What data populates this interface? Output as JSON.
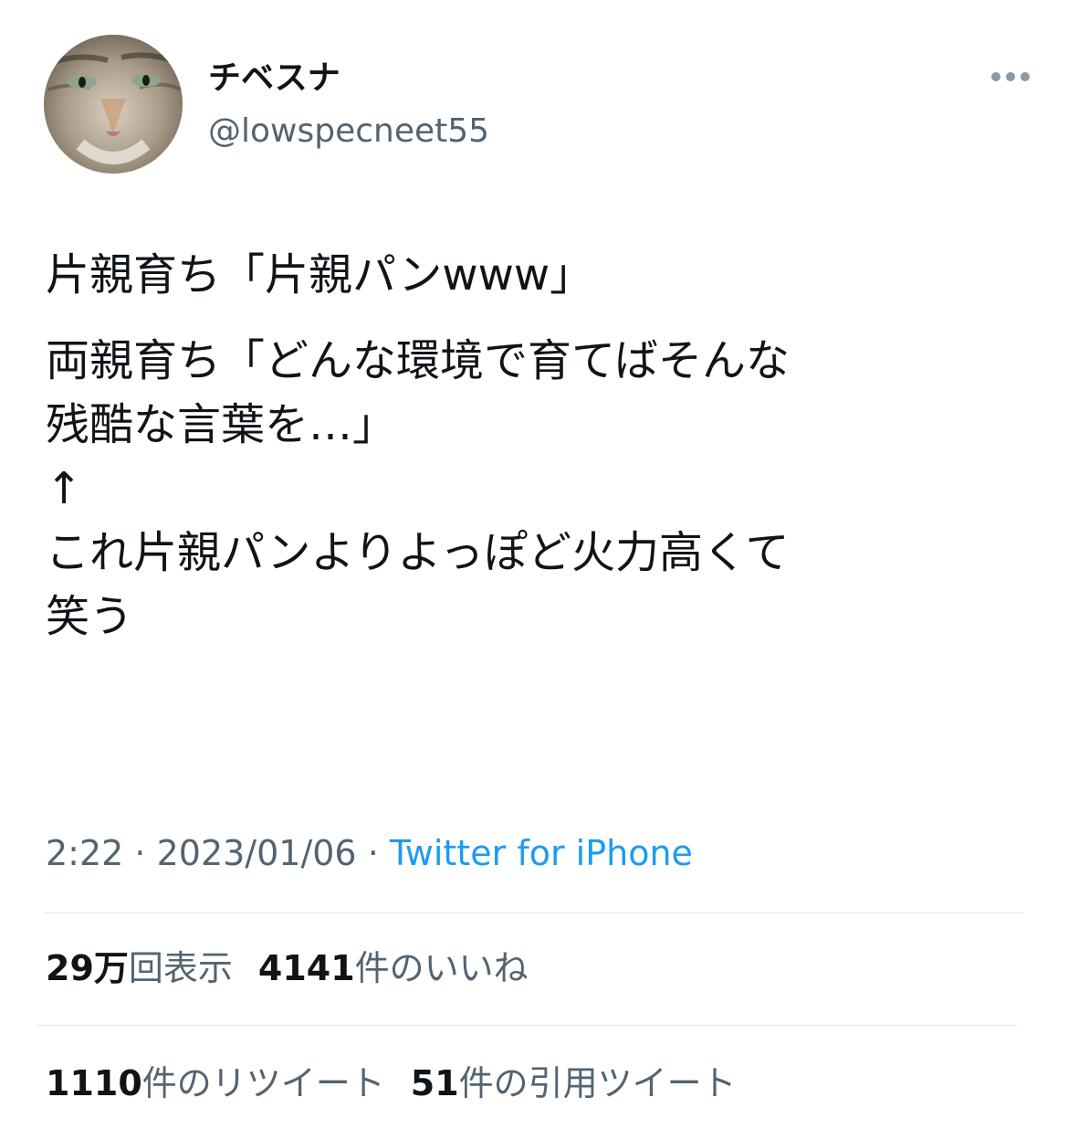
{
  "author": {
    "display_name": "チベスナ",
    "handle": "@lowspecneet55",
    "avatar_icon": "cat-avatar-icon"
  },
  "tweet": {
    "lines": [
      "片親育ち「片親パンwww」",
      "両親育ち「どんな環境で育てばそんな",
      "残酷な言葉を…」",
      "↑",
      "これ片親パンよりよっぽど火力高くて",
      "笑う"
    ]
  },
  "meta": {
    "time": "2:22",
    "separator": " · ",
    "date": "2023/01/06",
    "source": "Twitter for iPhone"
  },
  "stats": {
    "views_count": "29万",
    "views_label": "回表示",
    "likes_count": "4141",
    "likes_label": "件のいいね",
    "retweets_count": "1110",
    "retweets_label": "件のリツイート",
    "quotes_count": "51",
    "quotes_label": "件の引用ツイート"
  },
  "colors": {
    "text": "#0f1419",
    "secondary": "#536471",
    "link": "#1d9bf0"
  }
}
